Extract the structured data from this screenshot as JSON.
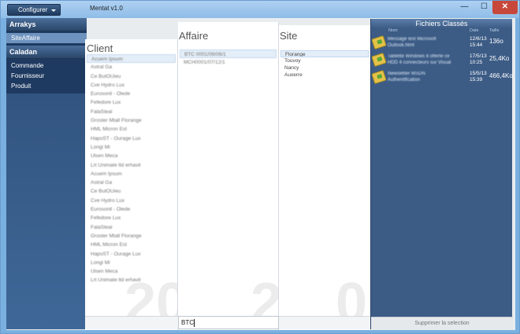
{
  "window": {
    "title": "Mentat v1.0",
    "configurer_label": "Configurer",
    "min_glyph": "—",
    "max_glyph": "☐",
    "close_glyph": "✕"
  },
  "nav": {
    "groups": [
      {
        "label": "Arrakys",
        "items": [
          {
            "label": "SiteAffaire",
            "active": true
          }
        ]
      },
      {
        "label": "Caladan",
        "items": [
          {
            "label": "Commande"
          },
          {
            "label": "Fournisseur"
          },
          {
            "label": "Produit"
          }
        ]
      }
    ]
  },
  "client": {
    "header": "Client",
    "watermark": "20",
    "rows": [
      "Acuem Ipsum",
      "Astral Ga",
      "Ce ButOUieu",
      "Cve Hydro Lux",
      "Eurosonil - Olede",
      "Fefedore Lux",
      "FalaSteal",
      "Groster Mtall Florange",
      "HML Micron Est",
      "HapoST - Ourage Lux",
      "Longi Mi",
      "Ulsen Meca",
      "Lrt Unimate ltd erhavit",
      "Acuem Ipsum",
      "Astral Ga",
      "Ce ButOUieu",
      "Cve Hydro Lux",
      "Eurosonil - Olede",
      "Fefedore Lux",
      "FalaSteal",
      "Groster Mtall Florange",
      "HML Micron Est",
      "HapoST - Ourage Lux",
      "Longi Mi",
      "Ulsen Meca",
      "Lrt Unimate ltd erhavit"
    ]
  },
  "affaire": {
    "header": "Affaire",
    "watermark": "2",
    "rows": [
      "BTC 0001/09/06/1",
      "MCH0001/07/12/1"
    ],
    "search_value": "BTC"
  },
  "site": {
    "header": "Site",
    "watermark": "0",
    "rows": [
      "Florange",
      "Touvoy",
      "Nancy",
      "Auxerre"
    ]
  },
  "fichiers": {
    "title": "Fichiers Classés",
    "col_nom": "Nom",
    "col_date": "Date",
    "col_taille": "Taille",
    "files": [
      {
        "name_line1": "Message test Microsoft",
        "name_line2": "Outlook.html",
        "date_line1": "12/6/13",
        "date_line2": "15:44",
        "size": "136o"
      },
      {
        "name_line1": "Tablette Windows 8 offerte ce",
        "name_line2": "HDD 4 connecteurs sur Visual",
        "date_line1": "17/5/13",
        "date_line2": "10:25",
        "size": "25,4Ko"
      },
      {
        "name_line1": "Newsletter MSDN",
        "name_line2": "Authentification",
        "date_line1": "15/5/13",
        "date_line2": "15:39",
        "size": "466,4Ko"
      }
    ],
    "delete_button": "Supprimer la selection"
  }
}
